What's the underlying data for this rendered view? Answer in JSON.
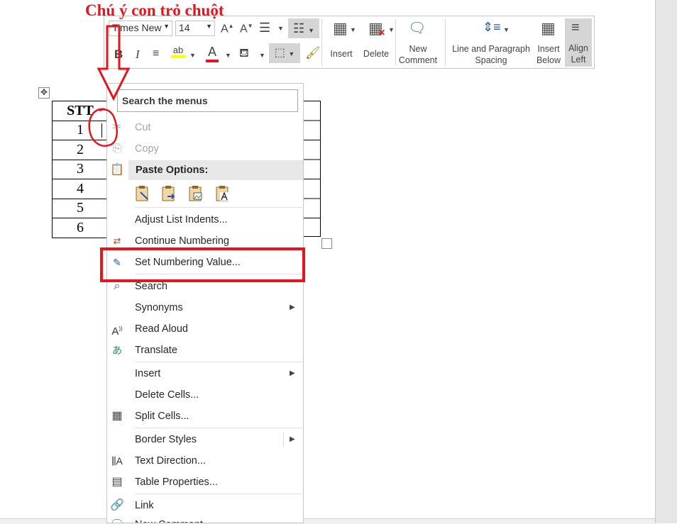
{
  "annotation": {
    "title": "Chú ý con trỏ chuột"
  },
  "mini_toolbar": {
    "font_name": "Times New",
    "font_size": "14",
    "buttons": {
      "insert": "Insert",
      "delete": "Delete",
      "new_comment_line1": "New",
      "new_comment_line2": "Comment",
      "line_spacing_line1": "Line and Paragraph",
      "line_spacing_line2": "Spacing",
      "insert_below_line1": "Insert",
      "insert_below_line2": "Below",
      "align_left_line1": "Align",
      "align_left_line2": "Left"
    }
  },
  "table": {
    "header": "STT",
    "rows": [
      "1",
      "2",
      "3",
      "4",
      "5",
      "6"
    ]
  },
  "context_menu": {
    "search_placeholder": "Search the menus",
    "cut": "Cut",
    "copy": "Copy",
    "paste_options": "Paste Options:",
    "adjust_list_indents": "Adjust List Indents...",
    "continue_numbering": "Continue Numbering",
    "set_numbering_value": "Set Numbering Value...",
    "search": "Search",
    "synonyms": "Synonyms",
    "read_aloud": "Read Aloud",
    "translate": "Translate",
    "insert": "Insert",
    "delete_cells": "Delete Cells...",
    "split_cells": "Split Cells...",
    "border_styles": "Border Styles",
    "text_direction": "Text Direction...",
    "table_properties": "Table Properties...",
    "link": "Link",
    "new_comment": "New Comment"
  },
  "colors": {
    "annotation_red": "#e8141c",
    "word_blue": "#2b579a"
  }
}
